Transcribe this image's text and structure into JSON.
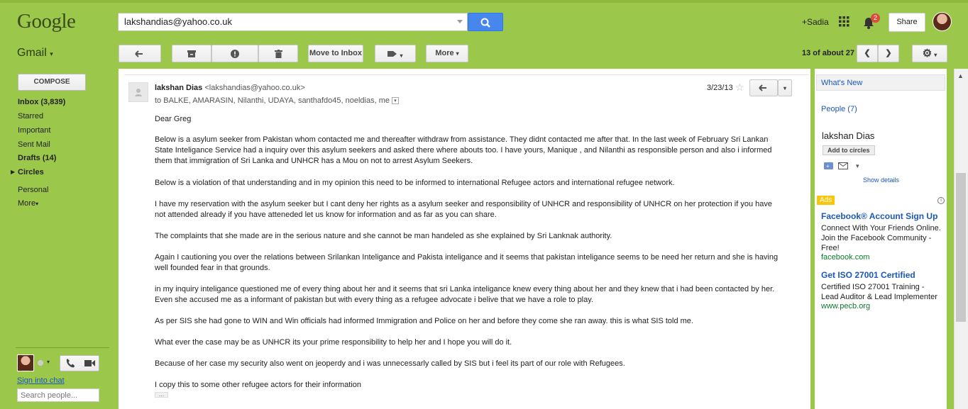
{
  "header": {
    "logo": "Google",
    "search_value": "lakshandias@yahoo.co.uk",
    "user": "+Sadia",
    "notif_count": "2",
    "share": "Share"
  },
  "toolbar": {
    "gmail": "Gmail",
    "move_to_inbox": "Move to Inbox",
    "more": "More",
    "pager": "13 of about 27"
  },
  "sidebar": {
    "compose": "COMPOSE",
    "items": [
      "Inbox (3,839)",
      "Starred",
      "Important",
      "Sent Mail",
      "Drafts (14)",
      "Circles",
      "Personal",
      "More"
    ],
    "sign_into_chat": "Sign into chat",
    "search_people_placeholder": "Search people..."
  },
  "message": {
    "sender_name": "lakshan Dias",
    "sender_email": "<lakshandias@yahoo.co.uk>",
    "date": "3/23/13",
    "recipients": "to BALKE, AMARASIN, Nilanthi, UDAYA, santhafdo45, noeldias, me",
    "paragraphs": [
      "Dear Greg",
      "Below is a asylum seeker from Pakistan whom contacted me and thereafter withdraw from assistance. They didnt contacted me after that. In the last week of February Sri Lankan State Inteligance Service had a inquiry over this asylum seekers and asked there where abouts too. I have yours, Manique , and Nilanthi as responsible person and also i informed them that immigration of Sri Lanka and UNHCR has a Mou on not to arrest Asylum Seekers.",
      "Below is a violation of that understanding and in my opinion this need to be informed to international Refugee actors and international refugee network.",
      "I have my reservation with the asylum seeker but I cant deny her rights as a asylum seeker and responsibility of UNHCR and responsibility of UNHCR on her protection if you have not attended already if you have atteneded let us know for information and as far as you can share.",
      "The complaints that she made are in the serious nature and she cannot be man handeled as she explained by Sri Lanknak authority.",
      "Again I cautioning you over the relations between Srilankan Inteligance and Pakista inteligance and it seems that pakistan inteligance seems to be need her return and she is having well founded fear in that grounds.",
      "in my inquiry inteligance questioned me of every thing about her and it seems that sri Lanka inteligance knew every thing about her and they knew that i had been contacted by her. Even she accused me as a informant of pakistan but with every thing as a refugee advocate i belive that we have a role to play.",
      "As per SIS she had gone to WIN and Win officials had informed Immigration and Police on her and before they come she ran away. this is what SIS told me.",
      "What ever the case may be as UNHCR its your prime responsibility to help her and I hope you will do it.",
      "Because of her case my security also went on jeoperdy and i was unnecessarly called by SIS but i feel its part of our role with Refugees.",
      "I copy this to some other refugee actors for their information"
    ],
    "show_trimmed": "..."
  },
  "right": {
    "whats_new": "What's New",
    "people": "People (7)",
    "contact_name": "lakshan Dias",
    "add_to_circles": "Add to circles",
    "show_details": "Show details",
    "ads_label": "Ads",
    "ads": [
      {
        "title": "Facebook® Account Sign Up",
        "text": "Connect With Your Friends Online. Join the Facebook Community - Free!",
        "url": "facebook.com"
      },
      {
        "title": "Get ISO 27001 Certified",
        "text": "Certified ISO 27001 Training - Lead Auditor & Lead Implementer",
        "url": "www.pecb.org"
      }
    ]
  },
  "colors": {
    "green": "#9bc74a",
    "link": "#1c58b8",
    "search_blue": "#4787ed",
    "notif": "#dd4b39"
  }
}
